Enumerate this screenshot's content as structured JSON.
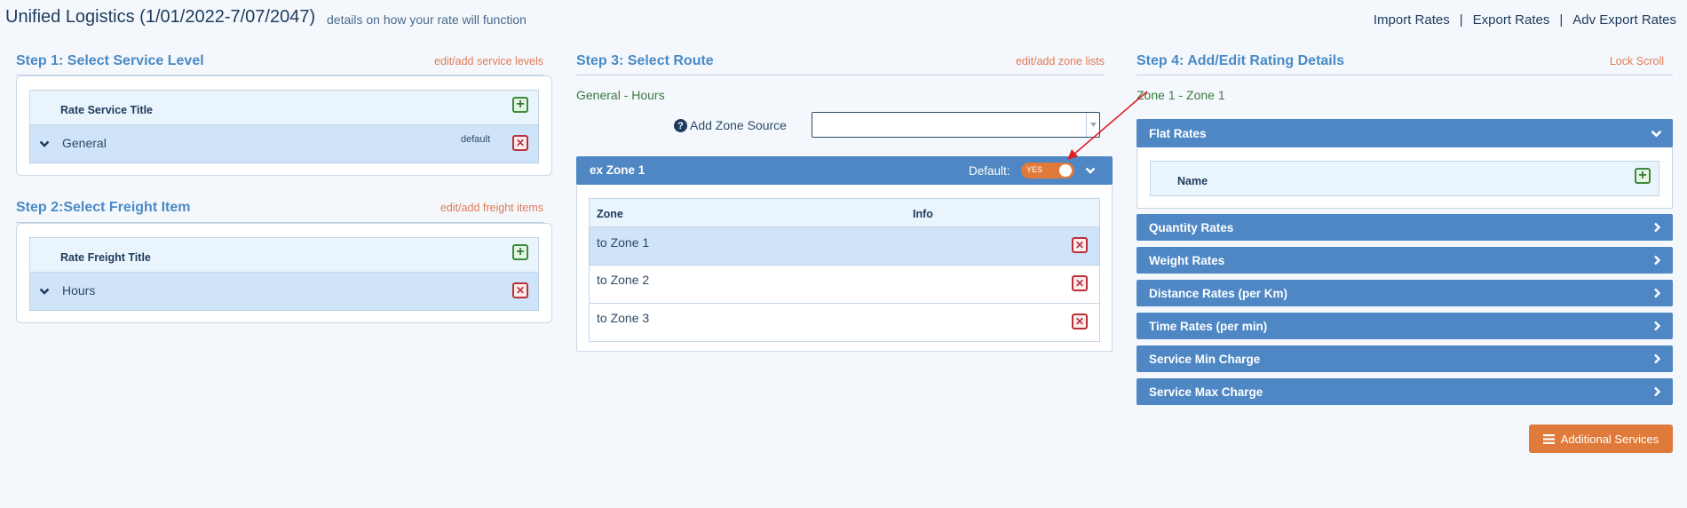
{
  "header": {
    "title": "Unified Logistics (1/01/2022-7/07/2047)",
    "subtitle": "details on how your rate will function",
    "links": [
      "Import Rates",
      "Export Rates",
      "Adv Export Rates"
    ]
  },
  "step1": {
    "title": "Step 1: Select Service Level",
    "link": "edit/add service levels",
    "column": "Rate Service Title",
    "row": {
      "label": "General",
      "badge": "default"
    }
  },
  "step2": {
    "title": "Step 2:Select Freight Item",
    "link": "edit/add freight items",
    "column": "Rate Freight Title",
    "row": {
      "label": "Hours"
    }
  },
  "step3": {
    "title": "Step 3: Select Route",
    "link": "edit/add zone lists",
    "breadcrumb": "General - Hours",
    "zone_source_label": "Add Zone Source",
    "zone_source_value": "",
    "zone_panel": {
      "title": "ex Zone 1",
      "default_label": "Default:",
      "toggle_label": "YES",
      "columns": [
        "Zone",
        "Info"
      ],
      "rows": [
        "to Zone 1",
        "to Zone 2",
        "to Zone 3"
      ]
    }
  },
  "step4": {
    "title": "Step 4: Add/Edit Rating Details",
    "link": "Lock Scroll",
    "breadcrumb": "Zone 1 - Zone 1",
    "flat_rates": {
      "label": "Flat Rates",
      "column": "Name"
    },
    "sections": [
      "Quantity Rates",
      "Weight Rates",
      "Distance Rates (per Km)",
      "Time Rates (per min)",
      "Service Min Charge",
      "Service Max Charge"
    ],
    "additional_button": "Additional Services"
  },
  "colors": {
    "accent_blue": "#4e87c4",
    "orange": "#e07a3a",
    "link_orange": "#e07a55",
    "add_green": "#3c8a3c",
    "delete_red": "#b8313a",
    "annotation_arrow": "#e02020"
  }
}
